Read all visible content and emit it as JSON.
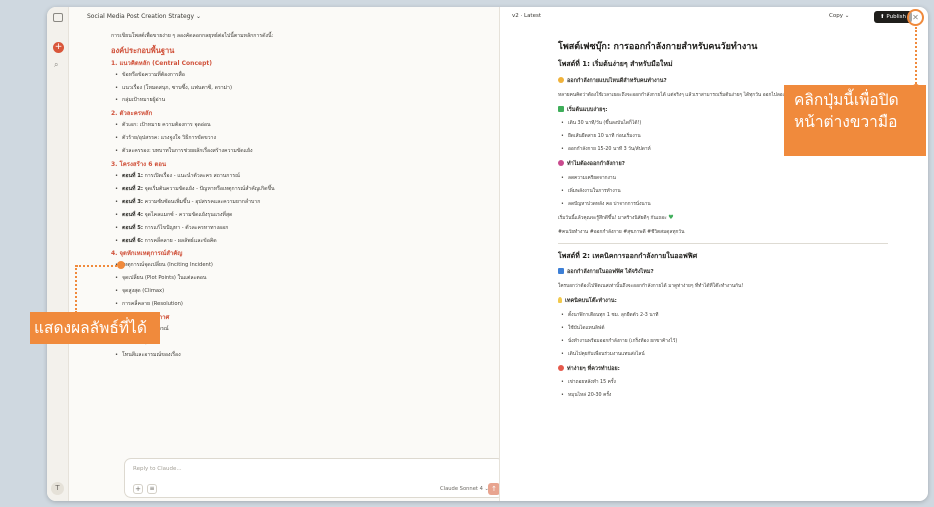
{
  "window": {
    "chat_title": "Social Media Post Creation Strategy ⌄",
    "version_label": "v2 · Latest",
    "copy_label": "Copy ⌄",
    "publish_label": "⬆ Publish",
    "close_glyph": "✕"
  },
  "rail": {
    "new_glyph": "+",
    "search_glyph": "⌕",
    "avatar_initial": "T"
  },
  "chat": {
    "intro": "การเขียนโพสต์เพื่อขายง่าย ๆ ลองคัดลอกกลยุทธ์ต่อไปนี้ตามหลักการดังนี้:",
    "heading": "องค์ประกอบพื้นฐาน",
    "sections": [
      {
        "title": "1. แนวคิดหลัก (Central Concept)",
        "items": [
          {
            "bold": "",
            "text": "ข้อหรือข้อความที่ต้องการสื่อ"
          },
          {
            "bold": "",
            "text": "แนวเรื่อง (โหมดสนุก, ซาบซึ้ง, แฟนตาซี, ดราม่า)"
          },
          {
            "bold": "",
            "text": "กลุ่มเป้าหมายผู้อ่าน"
          }
        ]
      },
      {
        "title": "2. ตัวละครหลัก",
        "items": [
          {
            "bold": "",
            "text": "ตัวเอก: เป้าหมาย ความต้องการ จุดอ่อน"
          },
          {
            "bold": "",
            "text": "ตัวร้าย/อุปสรรค: แรงจูงใจ วิธีการขัดขวาง"
          },
          {
            "bold": "",
            "text": "ตัวละครรอง: บทบาทในการช่วยผลักเรื่องสร้างความขัดแย้ง"
          }
        ]
      },
      {
        "title": "3. โครงสร้าง 6 ตอน",
        "items": [
          {
            "bold": "ตอนที่ 1:",
            "text": " การเปิดเรื่อง - แนะนำตัวละคร สถานการณ์"
          },
          {
            "bold": "ตอนที่ 2:",
            "text": " จุดเริ่มต้นความขัดแย้ง - ปัญหาหรือเหตุการณ์สำคัญเกิดขึ้น"
          },
          {
            "bold": "ตอนที่ 3:",
            "text": " ความซับซ้อนเพิ่มขึ้น - อุปสรรคและความยากลำบาก"
          },
          {
            "bold": "ตอนที่ 4:",
            "text": " จุดไคลแมกซ์ - ความขัดแย้งรุนแรงที่สุด"
          },
          {
            "bold": "ตอนที่ 5:",
            "text": " การแก้ไขปัญหา - ตัวละครหาทางออก"
          },
          {
            "bold": "ตอนที่ 6:",
            "text": " การคลี่คลาย - ผลลัพธ์และข้อคิด"
          }
        ]
      },
      {
        "title": "4. จุดหักเหเหตุการณ์สำคัญ",
        "items": [
          {
            "bold": "",
            "text": "เหตุการณ์จุดเปลี่ยน (Inciting Incident)"
          },
          {
            "bold": "",
            "text": "จุดเปลี่ยน (Plot Points) ในแต่ละตอน"
          },
          {
            "bold": "",
            "text": "จุดสูงสุด (Climax)"
          },
          {
            "bold": "",
            "text": "การคลี่คลาย (Resolution)"
          }
        ]
      },
      {
        "title": "5. ฉากและบรรยากาศ",
        "items": [
          {
            "bold": "",
            "text": "สถานที่เกิดเหตุการณ์"
          },
          {
            "bold": "",
            "text": "ช่วงเวลา/ยุคสมัย"
          },
          {
            "bold": "",
            "text": "โทนสีและอารมณ์ของเรื่อง"
          }
        ]
      }
    ],
    "input_placeholder": "Reply to Claude...",
    "plus_glyph": "+",
    "options_glyph": "≡",
    "model_label": "Claude Sonnet 4 ⌄",
    "send_glyph": "↑"
  },
  "artifact": {
    "title": "โพสต์เฟซบุ๊ก: การออกกำลังกายสำหรับคนวัยทำงาน",
    "post1": {
      "heading": "โพสต์ที่ 1: เริ่มต้นง่ายๆ สำหรับมือใหม่",
      "hook": "ออกกำลังกายแบบไหนดีสำหรับคนทำงาน?",
      "para": "หลายคนคิดว่าต้องใช้เวลาเยอะถึงจะออกกำลังกายได้ แต่จริงๆ แล้วเราสามารถเริ่มต้นง่ายๆ ได้ทุกวัน ออกไปลอง ลองดู!",
      "sub1": "เริ่มต้นแบบง่ายๆ:",
      "list1": [
        "เดิน 30 นาที/วัน (ขึ้นลงบันไดก็ได้!)",
        "ยืดเส้นยืดสาย 10 นาที ก่อนเริ่มงาน",
        "ออกกำลังกาย 15-20 นาที 3 วัน/สัปดาห์"
      ],
      "sub2": "ทำไมต้องออกกำลังกาย?",
      "list2": [
        "ลดความเครียดจากงาน",
        "เพิ่มพลังงานในการทำงาน",
        "ลดปัญหาปวดหลัง คอ บ่าจากการนั่งนาน"
      ],
      "closing": "เริ่มวันนี้แล้วคุณจะรู้สึกดีขึ้น! มาสร้างนิสัยดีๆ กันเถอะ",
      "hashtags": "#คนวัยทำงาน #ออกกำลังกาย #สุขภาพดี #ชีวิตสมดุลทุกวัน"
    },
    "post2": {
      "heading": "โพสต์ที่ 2: เทคนิคการออกกำลังกายในออฟฟิศ",
      "hook": "ออกกำลังกายในออฟฟิศ ได้จริงไหม?",
      "para": "ใครบอกว่าต้องไปฟิตเนสเท่านั้นถึงจะออกกำลังกายได้ มาดูท่าง่ายๆ ที่ทำได้ที่โต๊ะทำงานกัน!",
      "sub1": "เทคนิคบนโต๊ะทำงาน:",
      "list1": [
        "ตั้งนาฬิกาเตือนทุก 1 ชม. ลุกยืดตัว 2-3 นาที",
        "ใช้บันไดแทนลิฟต์",
        "นั่งทำงานพร้อมออกกำลังกาย (เกร็งท้อง ยกขาค้างไว้)",
        "เดินไปคุยกับเพื่อนร่วมงานแทนส่งไลน์"
      ],
      "sub2": "ท่าง่ายๆ ที่ควรทำบ่อย:",
      "list2": [
        "เข่าถอยหลังทำ 15 ครั้ง",
        "หมุนไหล่ 20-30 ครั้ง"
      ]
    }
  },
  "annotations": {
    "close_hint": "คลิกปุ่มนี้เพื่อปิดหน้าต่างขวามือ",
    "result_hint": "แสดงผลลัพธ์ที่ได้"
  }
}
